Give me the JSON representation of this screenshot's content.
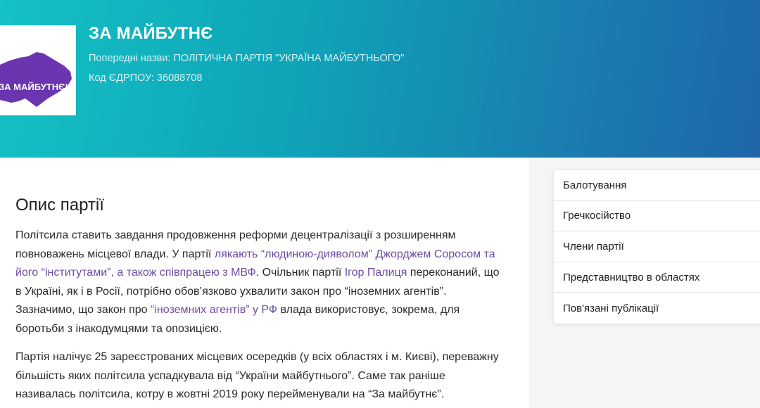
{
  "header": {
    "logo_text": "ЗА МАЙБУТНЄ!",
    "party_name": "ЗА МАЙБУТНЄ",
    "previous_names": "Попередні назви: ПОЛІТИЧНА ПАРТІЯ \"УКРАЇНА МАЙБУТНЬОГО\"",
    "edrpou": "Код ЄДРПОУ: 36088708"
  },
  "colors": {
    "header_gradient_start": "#14c1c4",
    "header_gradient_end": "#1e66a8",
    "link": "#6a4ea1",
    "logo_purple": "#6b35b0"
  },
  "main": {
    "section_title": "Опис партії",
    "p1": {
      "t1": "Політсила ставить завдання продовження реформи децентралізації з розширенням повноважень місцевої влади. У партії ",
      "link1": "лякають “людиною-дияволом” Джорджем Соросом та його “інститутами”, а також співпрацею з МВФ",
      "t2": ". Очільник партії ",
      "link2": "Ігор Палиця",
      "t3": " переконаний, що в Україні, як і в Росії, потрібно обов’язково ухвалити закон про “іноземних агентів”. Зазначимо, що закон про ",
      "link3": "“іноземних агентів” у РФ",
      "t4": " влада використовує, зокрема, для боротьби з інакодумцями та опозицією."
    },
    "p2": "Партія налічує 25 зареєстрованих місцевих осередків (у всіх областях і м. Києві), переважну більшість яких політсила успадкувала від “України майбутнього”. Саме так раніше називалась політсила, котру в жовтні 2019 року перейменували на “За майбутнє”."
  },
  "sidebar": {
    "items": [
      {
        "label": "Балотування"
      },
      {
        "label": "Гречкосійство"
      },
      {
        "label": "Члени партії"
      },
      {
        "label": "Представництво в областях"
      },
      {
        "label": "Пов'язані публікації"
      }
    ]
  }
}
